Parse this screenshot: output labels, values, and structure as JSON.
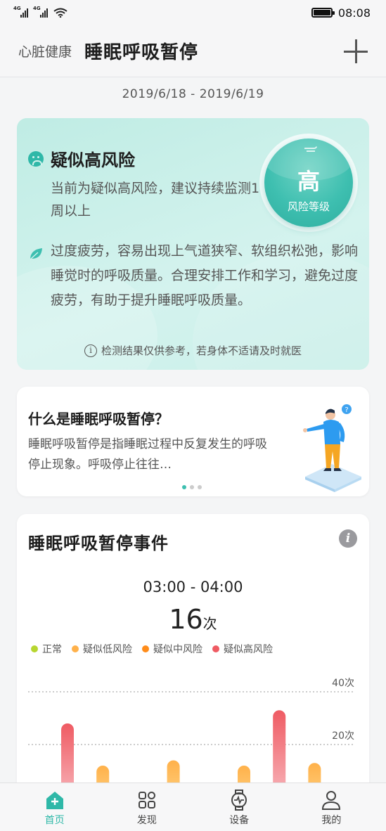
{
  "status_bar": {
    "net1": "4G",
    "net2": "4G",
    "time": "08:08"
  },
  "header": {
    "breadcrumb": "心脏健康",
    "title": "睡眠呼吸暂停"
  },
  "date_range": "2019/6/18  -  2019/6/19",
  "risk": {
    "title": "疑似高风险",
    "subtitle": "当前为疑似高风险，建议持续监测1周以上",
    "level": "高",
    "level_label": "风险等级",
    "advice": "过度疲劳，容易出现上气道狭窄、软组织松弛，影响睡觉时的呼吸质量。合理安排工作和学习，避免过度疲劳，有助于提升睡眠呼吸质量。",
    "disclaimer": "检测结果仅供参考，若身体不适请及时就医"
  },
  "info_card": {
    "question": "什么是睡眠呼吸暂停？",
    "description": "睡眠呼吸暂停是指睡眠过程中反复发生的呼吸停止现象。呼吸停止往往…"
  },
  "events": {
    "title": "睡眠呼吸暂停事件",
    "time_range": "03:00 - 04:00",
    "count": "16",
    "count_unit": "次",
    "legend": [
      {
        "label": "正常",
        "color": "#b7d630"
      },
      {
        "label": "疑似低风险",
        "color": "#ffb14a"
      },
      {
        "label": "疑似中风险",
        "color": "#ff8c1a"
      },
      {
        "label": "疑似高风险",
        "color": "#ef5b63"
      }
    ]
  },
  "chart_data": {
    "type": "bar",
    "y_unit": "次",
    "gridlines": [
      40,
      20
    ],
    "gridline_labels": [
      "40次",
      "20次"
    ],
    "values": [
      28,
      12,
      4,
      14,
      3,
      12,
      33,
      13
    ],
    "risk": [
      "high",
      "low",
      "normal",
      "low",
      "normal",
      "low",
      "high",
      "low"
    ]
  },
  "bottom_nav": [
    {
      "label": "首页",
      "icon": "home-icon",
      "active": true
    },
    {
      "label": "发现",
      "icon": "grid-icon",
      "active": false
    },
    {
      "label": "设备",
      "icon": "watch-icon",
      "active": false
    },
    {
      "label": "我的",
      "icon": "person-icon",
      "active": false
    }
  ]
}
